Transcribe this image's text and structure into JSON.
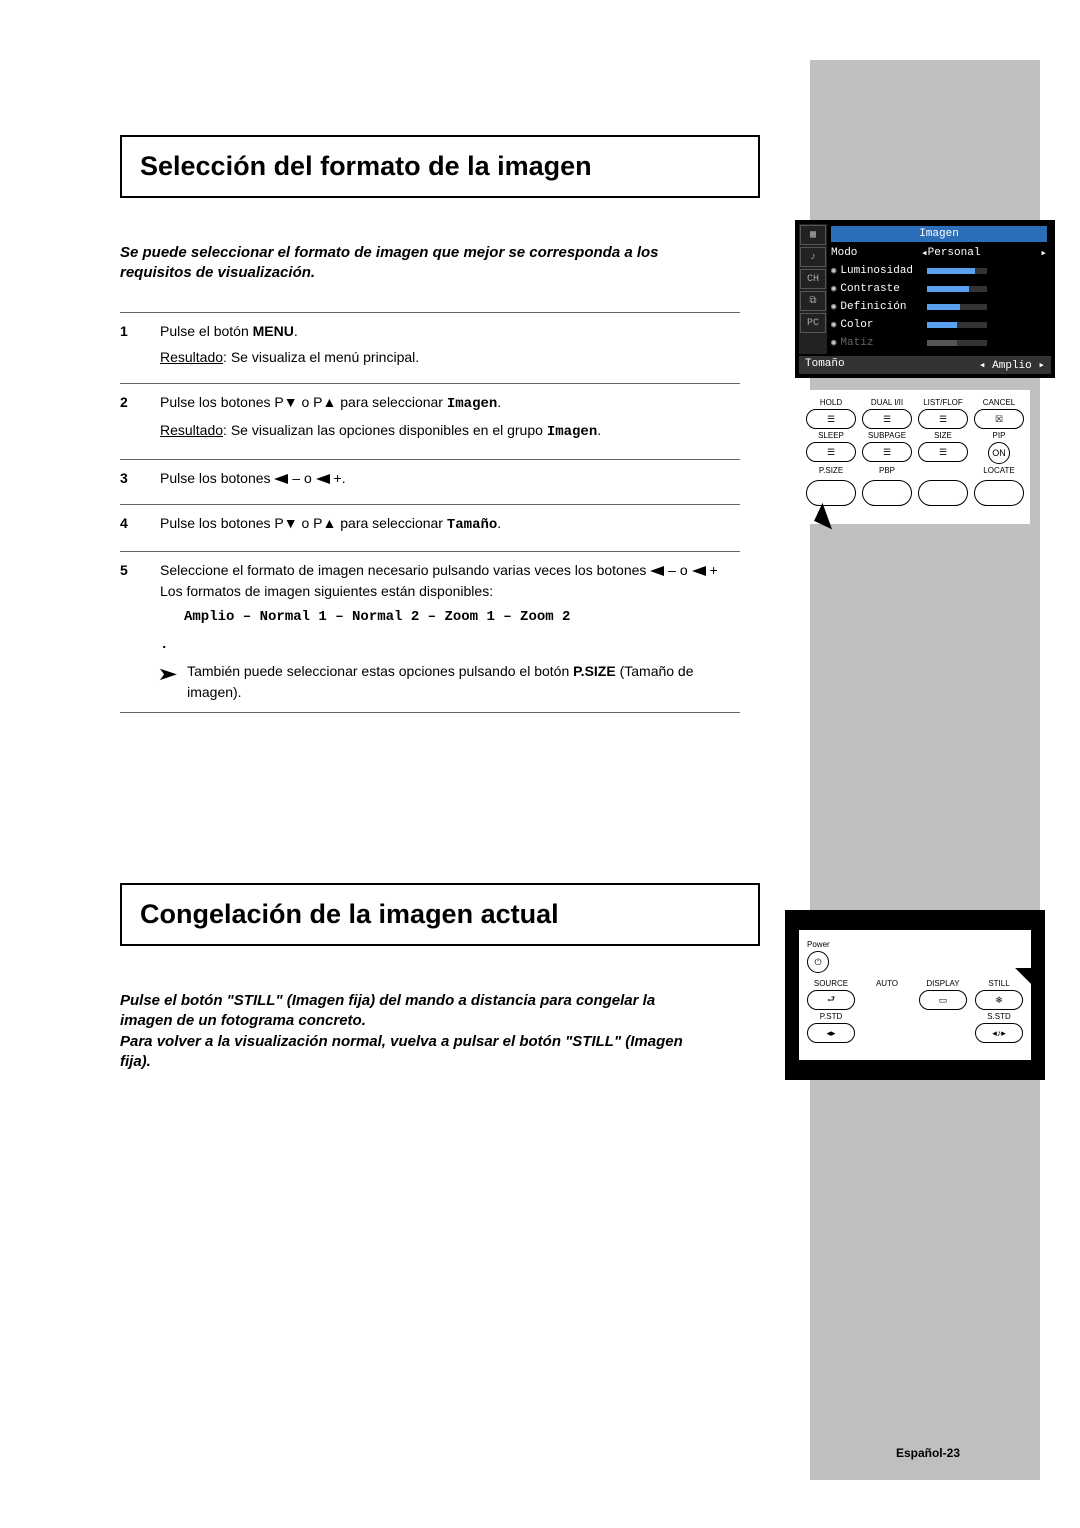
{
  "section1": {
    "heading": "Selección del formato de la imagen",
    "intro": "Se puede seleccionar el formato de imagen que mejor se corresponda a los requisitos de visualización.",
    "steps": [
      {
        "num": "1",
        "line1a": "Pulse el botón ",
        "line1b": "MENU",
        "line1c": ".",
        "result": "Resultado",
        "resultText": ": Se visualiza el menú principal."
      },
      {
        "num": "2",
        "pre": "Pulse los botones P▼ o P▲ para seleccionar ",
        "target": "Imagen",
        "post": ".",
        "result": "Resultado",
        "resultText": ": Se visualizan las opciones disponibles en el grupo ",
        "resultTarget": "Imagen",
        "resultPost": "."
      },
      {
        "num": "3",
        "text": "Pulse los botones ",
        "mid": " o ",
        "post": "."
      },
      {
        "num": "4",
        "pre": "Pulse los botones P▼ o P▲ para seleccionar ",
        "target": "Tamaño",
        "post": "."
      },
      {
        "num": "5",
        "text1": "Seleccione el formato de imagen necesario pulsando varias veces los botones ",
        "mid": " o ",
        "text2": " Los formatos de imagen siguientes están disponibles:",
        "modes": "Amplio – Normal 1 – Normal 2 – Zoom 1 – Zoom 2",
        "note1": "También puede seleccionar estas opciones pulsando el botón ",
        "note2": "P.SIZE",
        "note3": " (Tamaño de imagen)."
      }
    ]
  },
  "section2": {
    "heading": "Congelación de la imagen actual",
    "intro1": "Pulse el botón \"STILL\" (Imagen fija) del mando a distancia para congelar la imagen de un fotograma concreto.",
    "intro2": "Para volver a la visualización normal, vuelva a pulsar el botón \"STILL\" (Imagen fija)."
  },
  "osd": {
    "title": "Imagen",
    "rows": [
      {
        "label": "Modo",
        "value": "Personal",
        "arrows": true,
        "bar": null
      },
      {
        "label": "Luminosidad",
        "bar": 80
      },
      {
        "label": "Contraste",
        "bar": 70
      },
      {
        "label": "Definición",
        "bar": 55
      },
      {
        "label": "Color",
        "bar": 50
      },
      {
        "label": "Matiz",
        "bar": 50,
        "dim": true
      }
    ],
    "footer": {
      "left": "Tomaño",
      "right": "Amplio"
    }
  },
  "remote1": {
    "row1": [
      "HOLD",
      "DUAL I/II",
      "LIST/FLOF",
      "CANCEL"
    ],
    "row2": [
      "SLEEP",
      "SUBPAGE",
      "SIZE",
      "PIP"
    ],
    "row2v": [
      "",
      "",
      "",
      "ON"
    ],
    "row3": [
      "P.SIZE",
      "PBP",
      "",
      "LOCATE"
    ]
  },
  "remote2": {
    "power": "Power",
    "row": [
      "SOURCE",
      "AUTO",
      "DISPLAY",
      "STILL"
    ],
    "bottom": [
      "P.STD",
      "",
      "",
      "S.STD"
    ]
  },
  "pageNumber": "Español-23"
}
